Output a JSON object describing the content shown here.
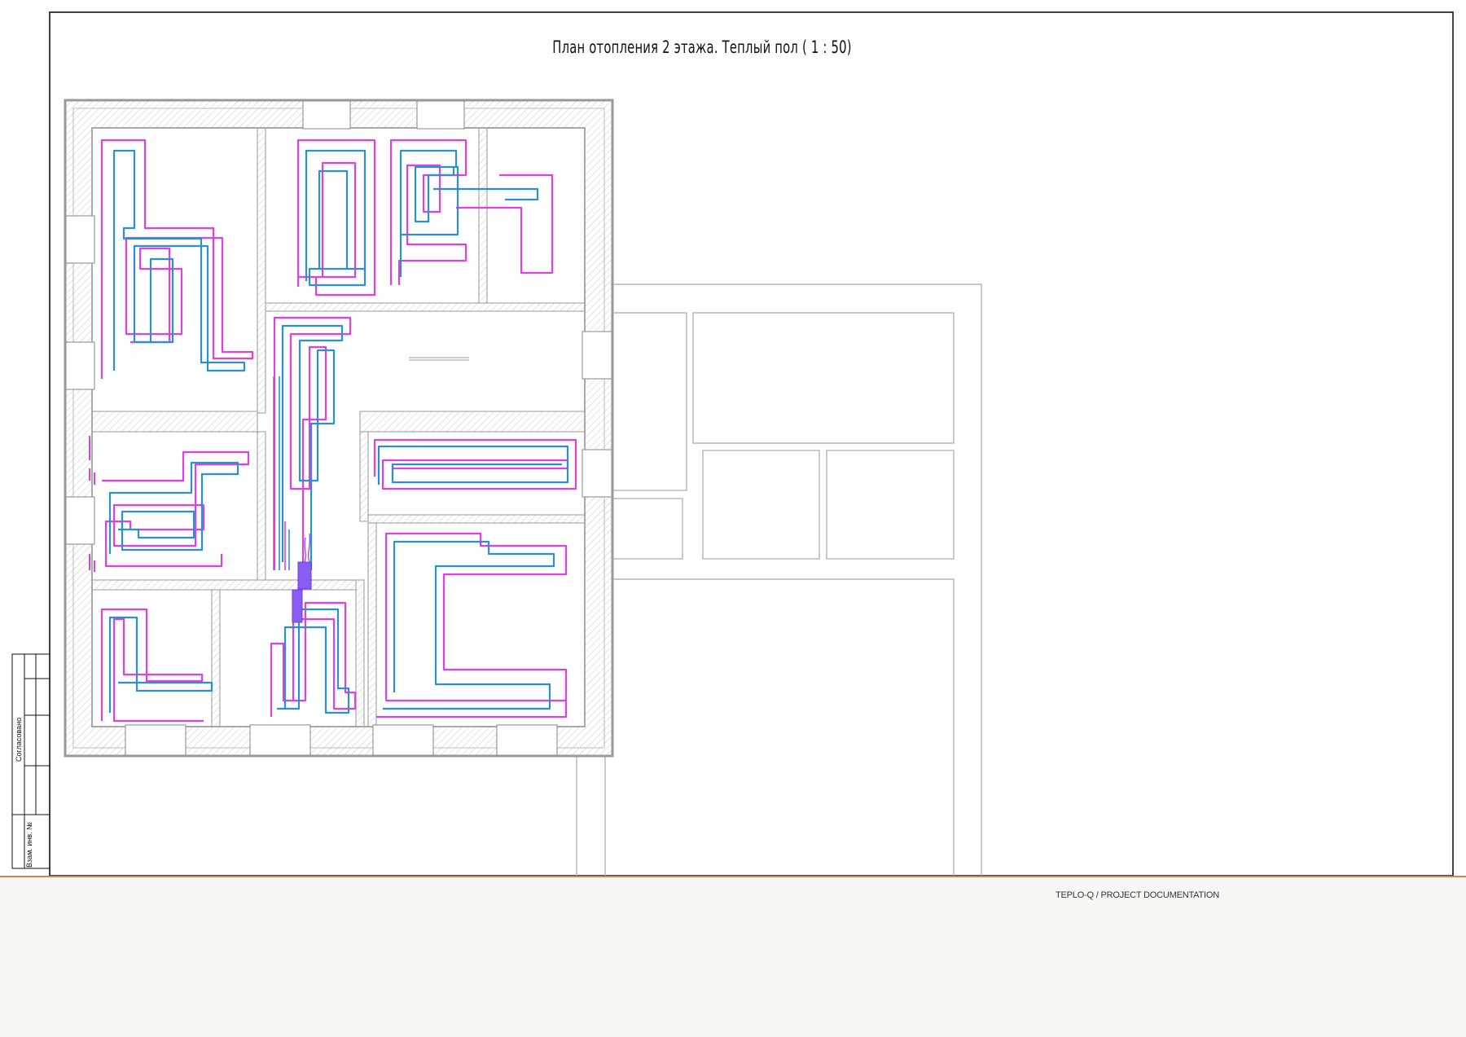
{
  "title": "План отопления 2 этажа. Теплый пол ( 1 : 50)",
  "stamp": {
    "approved_label": "Согласовано",
    "inv_label": "Взам. инв. №"
  },
  "footer": {
    "label": "TEPLO-Q / PROJECT DOCUMENTATION"
  },
  "colors": {
    "supply_pipe": "#e23ee6",
    "return_pipe": "#2a8fd6",
    "manifold": "#7b4ef0",
    "wall": "#9a9a9a",
    "footer_border": "#c58a5a"
  }
}
